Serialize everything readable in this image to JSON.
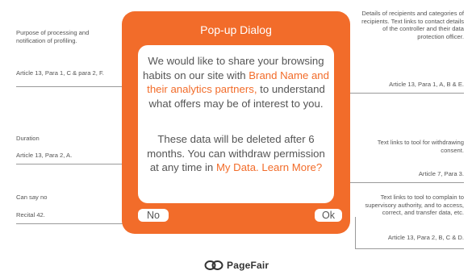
{
  "dialog": {
    "title": "Pop-up Dialog",
    "message1_part1": "We would like to share your browsing habits on our site with",
    "message1_highlight": "Brand Name and their analytics partners,",
    "message1_part2": "to understand what offers may be of interest to you.",
    "message2_part1": "These data will be deleted after 6 months. You can withdraw permission at any time in",
    "message2_link": "My Data.",
    "learn_more": "Learn More?",
    "no_label": "No",
    "ok_label": "Ok"
  },
  "annotations_left": [
    "Purpose of processing and notification of profiling.",
    "Article 13, Para 1, C & para 2, F.",
    "Duration",
    "Article 13, Para 2, A.",
    "Can say no",
    "Recital 42."
  ],
  "annotations_right": [
    "Details of recipients and categories of recipients. Text links to contact details of the controller and their data protection officer.",
    "Article 13, Para 1, A, B & E.",
    "Text links to tool for withdrawing consent.",
    "Article 7, Para 3.",
    "Text links to tool to complain to supervisory authority, and to access, correct, and transfer data, etc.",
    "Article 13, Para 2, B, C & D."
  ],
  "logo": {
    "name_part1": "Page",
    "name_part2": "Fair"
  }
}
